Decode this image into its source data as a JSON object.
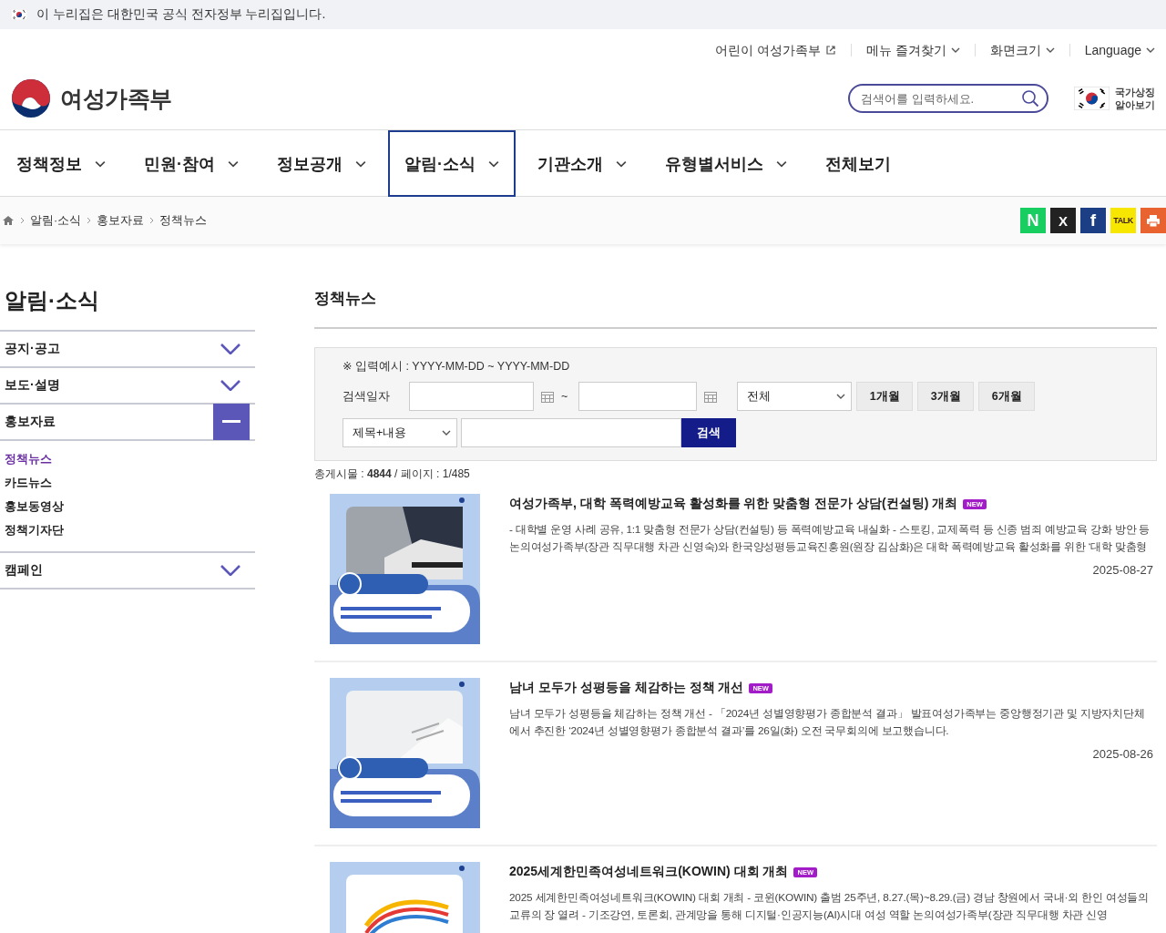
{
  "gov_banner": {
    "text": "이 누리집은 대한민국 공식 전자정부 누리집입니다."
  },
  "utility_links": [
    {
      "label": "어린이 여성가족부",
      "kind": "external"
    },
    {
      "label": "메뉴 즐겨찾기",
      "kind": "dropdown"
    },
    {
      "label": "화면크기",
      "kind": "dropdown"
    },
    {
      "label": "Language",
      "kind": "dropdown"
    }
  ],
  "logo": {
    "text": "여성가족부"
  },
  "search": {
    "placeholder": "검색어를 입력하세요."
  },
  "national_symbols": {
    "label": "국가상징 알아보기"
  },
  "nav": [
    {
      "label": "정책정보",
      "has_dropdown": true,
      "selected": false
    },
    {
      "label": "민원·참여",
      "has_dropdown": true,
      "selected": false
    },
    {
      "label": "정보공개",
      "has_dropdown": true,
      "selected": false
    },
    {
      "label": "알림·소식",
      "has_dropdown": true,
      "selected": true
    },
    {
      "label": "기관소개",
      "has_dropdown": true,
      "selected": false
    },
    {
      "label": "유형별서비스",
      "has_dropdown": true,
      "selected": false
    },
    {
      "label": "전체보기",
      "has_dropdown": false,
      "selected": false
    }
  ],
  "breadcrumb": [
    "알림·소식",
    "홍보자료",
    "정책뉴스"
  ],
  "share_buttons": [
    {
      "kind": "naver",
      "label": "N"
    },
    {
      "kind": "x",
      "label": "X"
    },
    {
      "kind": "facebook",
      "label": "f"
    },
    {
      "kind": "kakao",
      "label": "TALK"
    },
    {
      "kind": "print"
    }
  ],
  "sidebar": {
    "title": "알림·소식",
    "items": [
      {
        "label": "공지·공고",
        "expanded": false
      },
      {
        "label": "보도·설명",
        "expanded": false
      },
      {
        "label": "홍보자료",
        "expanded": true,
        "children": [
          {
            "label": "정책뉴스",
            "selected": true
          },
          {
            "label": "카드뉴스",
            "selected": false
          },
          {
            "label": "홍보동영상",
            "selected": false
          },
          {
            "label": "정책기자단",
            "selected": false
          }
        ]
      },
      {
        "label": "캠페인",
        "expanded": false
      }
    ]
  },
  "page_title": "정책뉴스",
  "search_form": {
    "hint": "※ 입력예시 : YYYY-MM-DD ~ YYYY-MM-DD",
    "date_label": "검색일자",
    "range_separator": "~",
    "period_select": "전체",
    "period_buttons": [
      "1개월",
      "3개월",
      "6개월"
    ],
    "field_select": "제목+내용",
    "search_button": "검색"
  },
  "summary": "총게시물 : **4844** / 페이지 : 1/485",
  "posts": [
    {
      "title": "여성가족부, 대학 폭력예방교육 활성화를 위한 맞춤형 전문가 상담(컨설팅) 개최",
      "badge": "NEW",
      "summary": "- 대학별 운영 사례 공유, 1:1 맞춤형 전문가 상담(컨설팅) 등 폭력예방교육 내실화 - 스토킹, 교제폭력 등 신종 범죄 예방교육 강화 방안 등 논의여성가족부(장관 직무대행 차관 신영숙)와 한국양성평등교육진흥원(원장 김삼화)은 대학 폭력예방교육 활성화를 위한 ‘대학 맞춤형",
      "date": "2025-08-27"
    },
    {
      "title": "남녀 모두가 성평등을 체감하는 정책 개선",
      "badge": "NEW",
      "summary": "남녀 모두가 성평등을 체감하는 정책 개선 - 「2024년 성별영향평가 종합분석 결과」 발표여성가족부는 중앙행정기관 및 지방자치단체에서 추진한 ‘2024년 성별영향평가 종합분석 결과’를 26일(화) 오전 국무회의에 보고했습니다.",
      "date": "2025-08-26"
    },
    {
      "title": "2025세계한민족여성네트워크(KOWIN) 대회 개최",
      "badge": "NEW",
      "summary": "2025 세계한민족여성네트워크(KOWIN) 대회 개최 - 코윈(KOWIN) 출범 25주년, 8.27.(목)~8.29.(금) 경남 창원에서 국내·외 한인 여성들의 교류의 장 열려 - 기조강연, 토론회, 관계망을 통해 디지털·인공지능(AI)시대 여성 역할 논의여성가족부(장관 직무대행 차관 신영"
    }
  ]
}
